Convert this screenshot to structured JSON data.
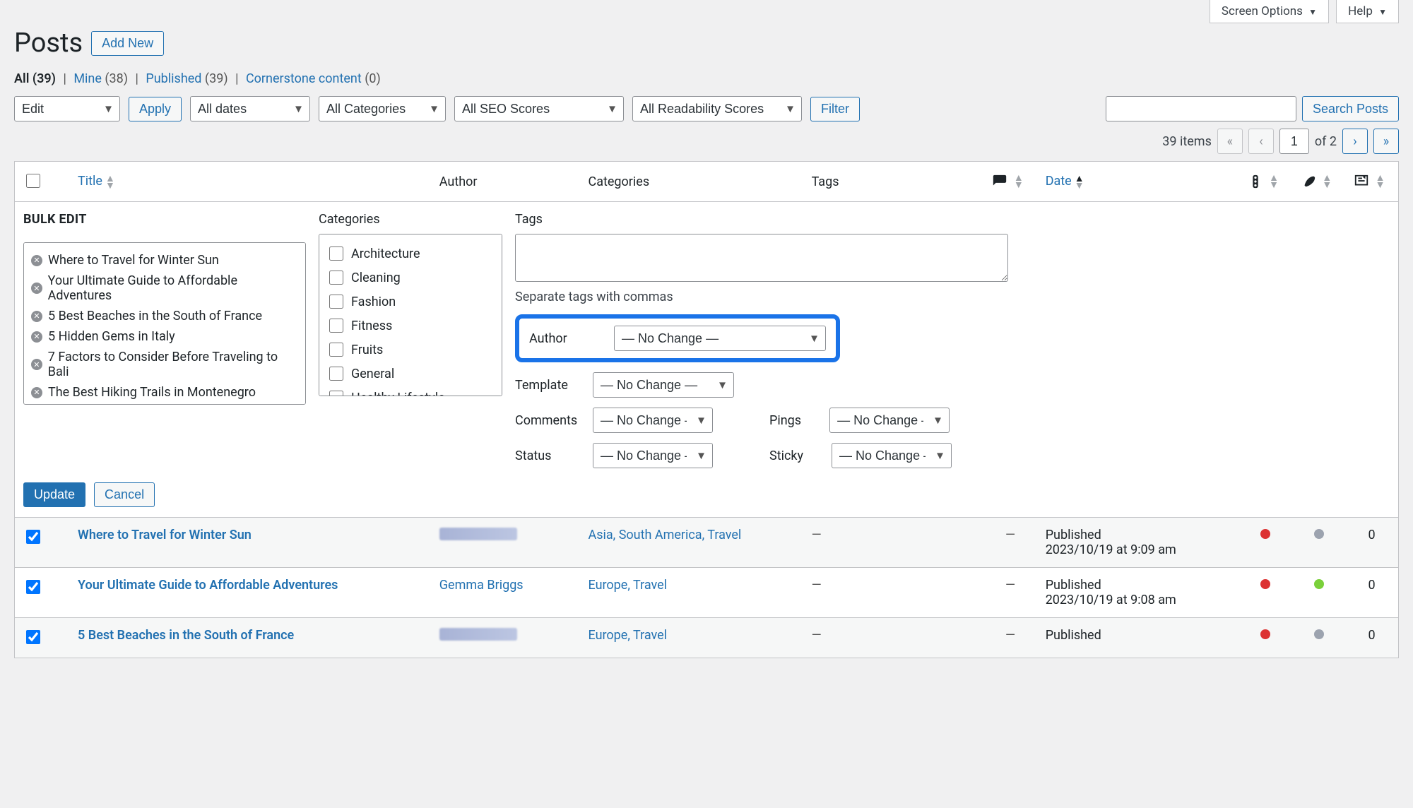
{
  "topRight": {
    "screenOptions": "Screen Options",
    "help": "Help"
  },
  "page": {
    "title": "Posts",
    "addNew": "Add New"
  },
  "views": {
    "all": {
      "label": "All",
      "count": "(39)"
    },
    "mine": {
      "label": "Mine",
      "count": "(38)"
    },
    "published": {
      "label": "Published",
      "count": "(39)"
    },
    "cornerstone": {
      "label": "Cornerstone content",
      "count": "(0)"
    }
  },
  "search": {
    "button": "Search Posts",
    "value": ""
  },
  "bulkActions": {
    "edit": "Edit",
    "apply": "Apply",
    "allDates": "All dates",
    "allCategories": "All Categories",
    "allSeo": "All SEO Scores",
    "allReadability": "All Readability Scores",
    "filter": "Filter"
  },
  "pagination": {
    "itemsText": "39 items",
    "current": "1",
    "ofText": "of 2"
  },
  "columns": {
    "title": "Title",
    "author": "Author",
    "categories": "Categories",
    "tags": "Tags",
    "date": "Date"
  },
  "bulkEdit": {
    "heading": "BULK EDIT",
    "categoriesLabel": "Categories",
    "tagsLabel": "Tags",
    "tagsHint": "Separate tags with commas",
    "posts": [
      "Where to Travel for Winter Sun",
      "Your Ultimate Guide to Affordable Adventures",
      "5 Best Beaches in the South of France",
      "5 Hidden Gems in Italy",
      "7 Factors to Consider Before Traveling to Bali",
      "The Best Hiking Trails in Montenegro"
    ],
    "categories": [
      "Architecture",
      "Cleaning",
      "Fashion",
      "Fitness",
      "Fruits",
      "General",
      "Healthy Lifestyle"
    ],
    "fields": {
      "author": {
        "label": "Author",
        "value": "— No Change —"
      },
      "template": {
        "label": "Template",
        "value": "— No Change —"
      },
      "comments": {
        "label": "Comments",
        "value": "— No Change —"
      },
      "pings": {
        "label": "Pings",
        "value": "— No Change —"
      },
      "status": {
        "label": "Status",
        "value": "— No Change —"
      },
      "sticky": {
        "label": "Sticky",
        "value": "— No Change —"
      }
    },
    "update": "Update",
    "cancel": "Cancel"
  },
  "rows": [
    {
      "title": "Where to Travel for Winter Sun",
      "author": "",
      "authorBlur": true,
      "categories": "Asia, South America, Travel",
      "tags": "—",
      "comments": "—",
      "status": "Published",
      "date": "2023/10/19 at 9:09 am",
      "seo": "red",
      "readability": "grey",
      "links": "0"
    },
    {
      "title": "Your Ultimate Guide to Affordable Adventures",
      "author": "Gemma Briggs",
      "authorBlur": false,
      "categories": "Europe, Travel",
      "tags": "—",
      "comments": "—",
      "status": "Published",
      "date": "2023/10/19 at 9:08 am",
      "seo": "red",
      "readability": "green",
      "links": "0"
    },
    {
      "title": "5 Best Beaches in the South of France",
      "author": "",
      "authorBlur": true,
      "categories": "Europe, Travel",
      "tags": "—",
      "comments": "—",
      "status": "Published",
      "date": "",
      "seo": "red",
      "readability": "grey",
      "links": "0"
    }
  ]
}
